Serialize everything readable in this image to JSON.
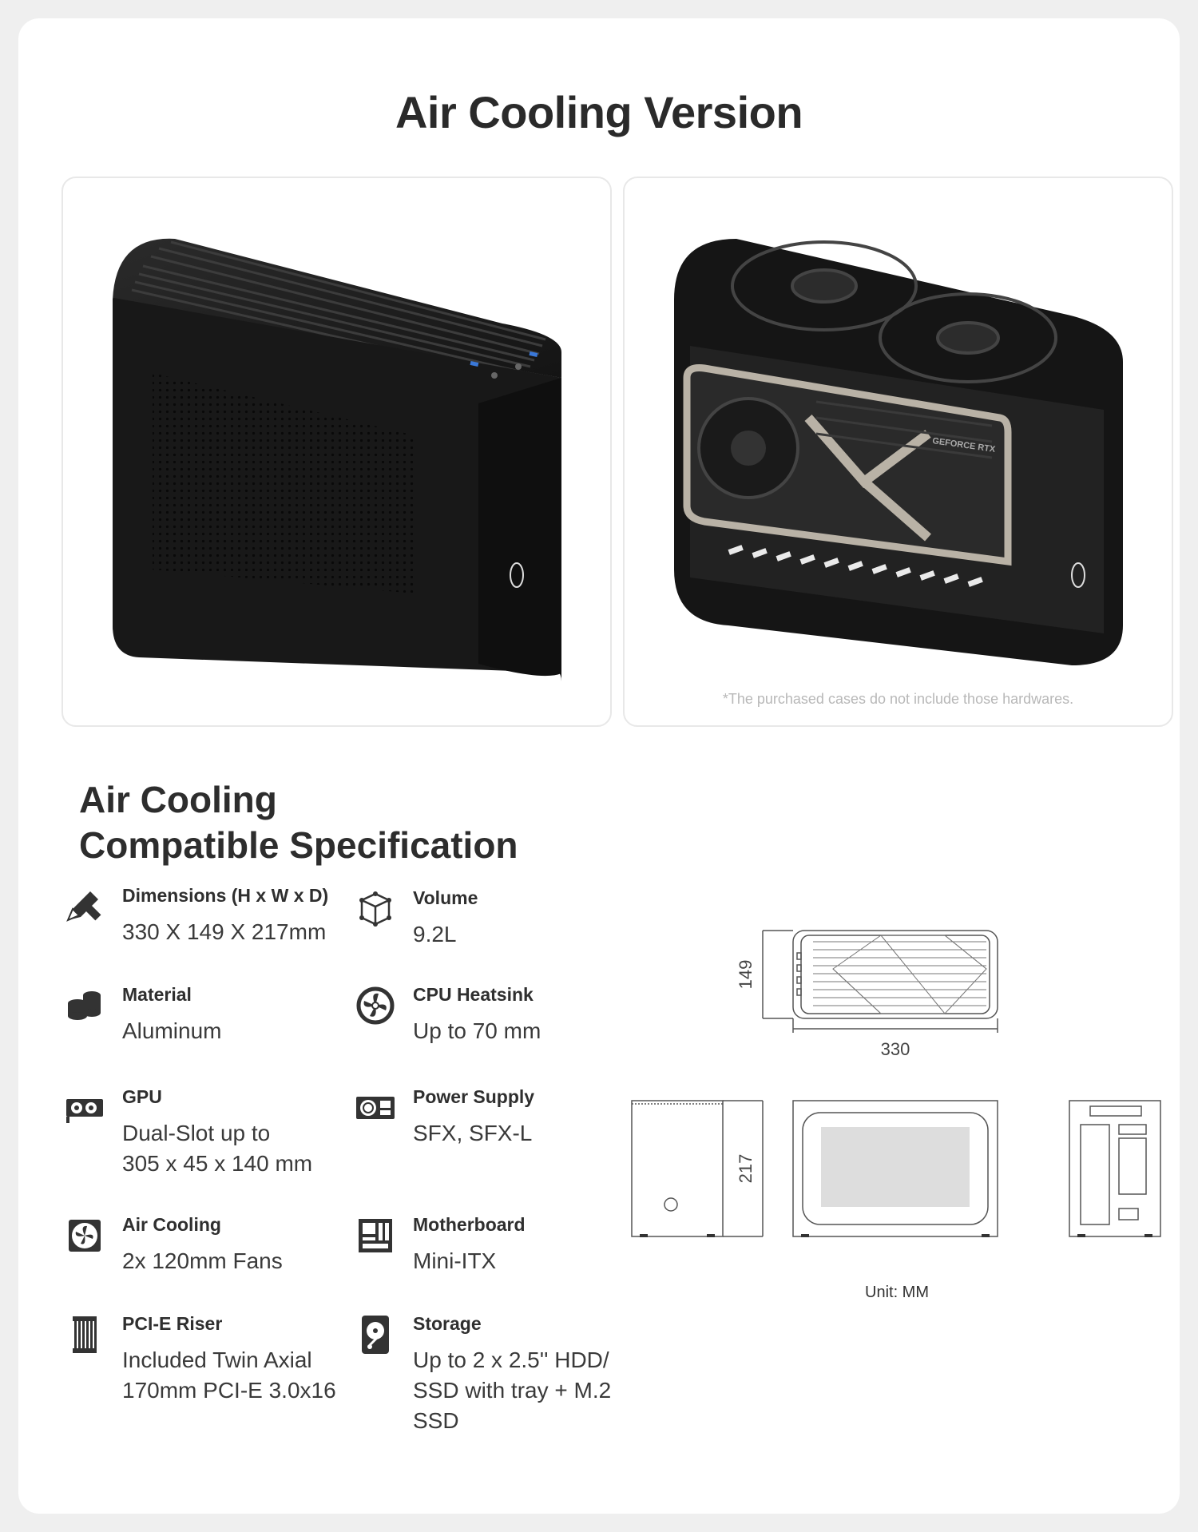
{
  "page": {
    "title": "Air Cooling Version"
  },
  "photos": {
    "disclaimer": "*The purchased cases do not include those hardwares.",
    "gpu_brand_text": "GEFORCE RTX"
  },
  "specs": {
    "heading_line1": "Air Cooling",
    "heading_line2": "Compatible Specification",
    "items": [
      {
        "icon": "pencil-ruler-icon",
        "label": "Dimensions (H x W x D)",
        "value_lines": [
          "330 X 149 X 217mm"
        ]
      },
      {
        "icon": "cube-icon",
        "label": "Volume",
        "value_lines": [
          "9.2L"
        ]
      },
      {
        "icon": "coin-stack-icon",
        "label": "Material",
        "value_lines": [
          "Aluminum"
        ]
      },
      {
        "icon": "fan-icon",
        "label": "CPU Heatsink",
        "value_lines": [
          "Up to 70 mm"
        ]
      },
      {
        "icon": "graphics-card-icon",
        "label": "GPU",
        "value_lines": [
          "Dual-Slot up to",
          "305 x 45 x 140 mm"
        ]
      },
      {
        "icon": "power-supply-icon",
        "label": "Power Supply",
        "value_lines": [
          "SFX, SFX-L"
        ]
      },
      {
        "icon": "fan-square-icon",
        "label": "Air Cooling",
        "value_lines": [
          "2x 120mm Fans"
        ]
      },
      {
        "icon": "motherboard-icon",
        "label": "Motherboard",
        "value_lines": [
          "Mini-ITX"
        ]
      },
      {
        "icon": "riser-cable-icon",
        "label": "PCI-E Riser",
        "value_lines": [
          "Included Twin Axial",
          "170mm PCI-E 3.0x16"
        ]
      },
      {
        "icon": "hard-drive-icon",
        "label": "Storage",
        "value_lines": [
          "Up to 2 x 2.5'' HDD/",
          "SSD with tray + M.2",
          "SSD"
        ]
      }
    ]
  },
  "drawing": {
    "dim_width": "330",
    "dim_depth": "149",
    "dim_height": "217",
    "unit_label": "Unit: MM"
  }
}
